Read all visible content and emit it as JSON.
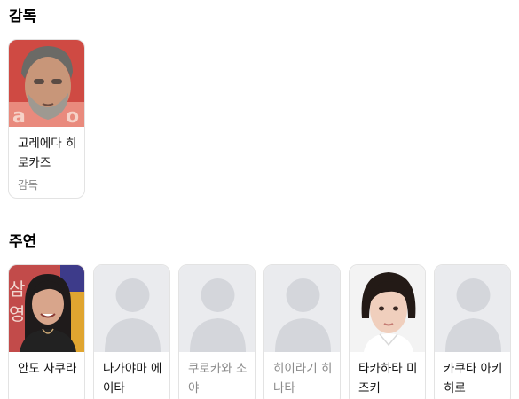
{
  "directors": {
    "title": "감독",
    "people": [
      {
        "name": "고레에다 히로카즈",
        "role": "감독",
        "photo": "photo"
      }
    ]
  },
  "cast": {
    "title": "주연",
    "people": [
      {
        "name": "안도 사쿠라",
        "photo": "photo"
      },
      {
        "name": "나가야마 에이타",
        "photo": "placeholder"
      },
      {
        "name": "쿠로카와 소야",
        "photo": "placeholder"
      },
      {
        "name": "히이라기 히나타",
        "photo": "placeholder"
      },
      {
        "name": "타카하타 미즈키",
        "photo": "photo"
      },
      {
        "name": "카쿠타 아키히로",
        "photo": "placeholder"
      }
    ]
  }
}
